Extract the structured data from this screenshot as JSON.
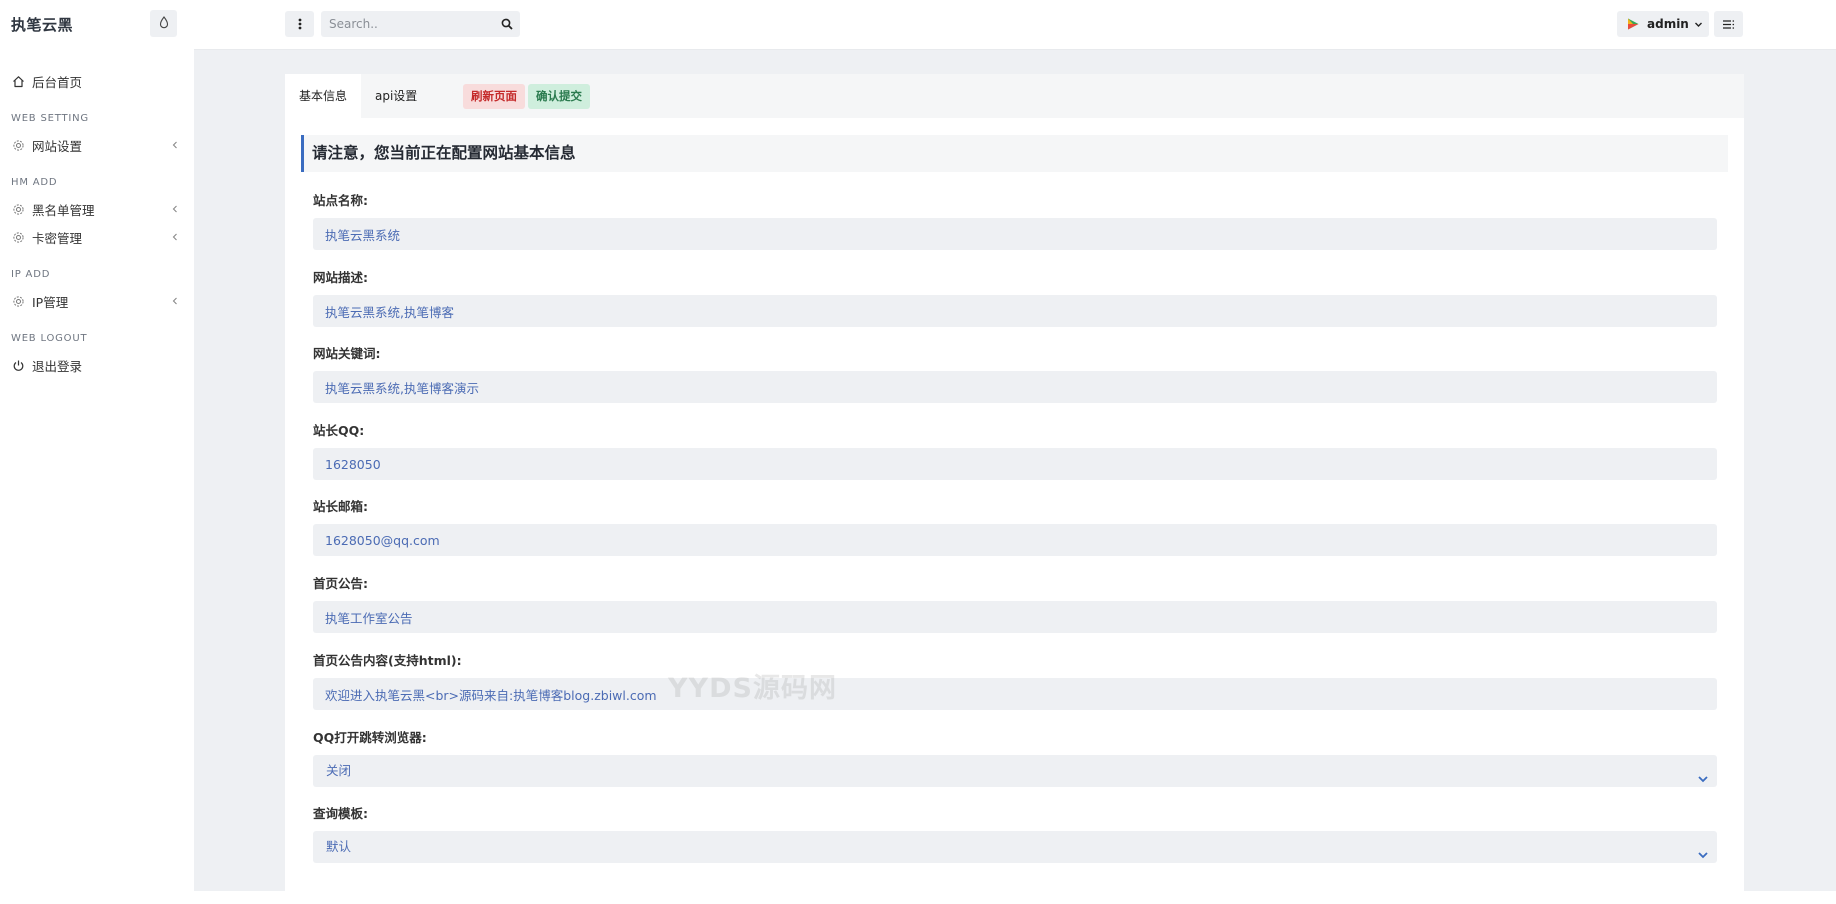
{
  "sidebar": {
    "brand": "执笔云黑",
    "theme_icon": "droplet-icon",
    "items": {
      "home": {
        "label": "后台首页",
        "icon": "home-icon"
      },
      "web_setting_heading": "WEB SETTING",
      "site_settings": {
        "label": "网站设置",
        "icon": "gear-icon"
      },
      "hm_add_heading": "HM ADD",
      "blacklist": {
        "label": "黑名单管理",
        "icon": "gear-icon"
      },
      "cardkey": {
        "label": "卡密管理",
        "icon": "gear-icon"
      },
      "ip_add_heading": "IP ADD",
      "ip_manage": {
        "label": "IP管理",
        "icon": "gear-icon"
      },
      "web_logout_heading": "WEB LOGOUT",
      "logout": {
        "label": "退出登录",
        "icon": "power-icon"
      }
    }
  },
  "topbar": {
    "search_placeholder": "Search..",
    "user_name": "admin",
    "icons": [
      "vertical-dots-icon",
      "search-icon",
      "user-avatar-icon",
      "chevron-down-icon",
      "list-menu-icon"
    ]
  },
  "card": {
    "tabs": [
      "基本信息",
      "api设置"
    ],
    "refresh_label": "刷新页面",
    "submit_label": "确认提交",
    "notice": "请注意，您当前正在配置网站基本信息"
  },
  "form": {
    "site_name": {
      "label": "站点名称:",
      "value": "执笔云黑系统"
    },
    "site_desc": {
      "label": "网站描述:",
      "value": "执笔云黑系统,执笔博客"
    },
    "site_keywords": {
      "label": "网站关键词:",
      "value": "执笔云黑系统,执笔博客演示"
    },
    "admin_qq": {
      "label": "站长QQ:",
      "value": "1628050"
    },
    "admin_email": {
      "label": "站长邮箱:",
      "value": "1628050@qq.com"
    },
    "home_notice": {
      "label": "首页公告:",
      "value": "执笔工作室公告"
    },
    "home_notice_html": {
      "label": "首页公告内容(支持html):",
      "value": "欢迎进入执笔云黑<br>源码来自:执笔博客blog.zbiwl.com"
    },
    "qq_redirect": {
      "label": "QQ打开跳转浏览器:",
      "selected": "关闭"
    },
    "query_template": {
      "label": "查询模板:",
      "selected": "默认"
    }
  },
  "watermark": "YYDS源码网",
  "colors": {
    "accent": "#3a6cc0",
    "refresh_bg": "#f8dcdc",
    "refresh_text": "#c42a2a",
    "submit_bg": "#cfeedd",
    "submit_text": "#2a7a4e",
    "input_text": "#4b6bb4",
    "main_bg": "#eef0f3"
  }
}
